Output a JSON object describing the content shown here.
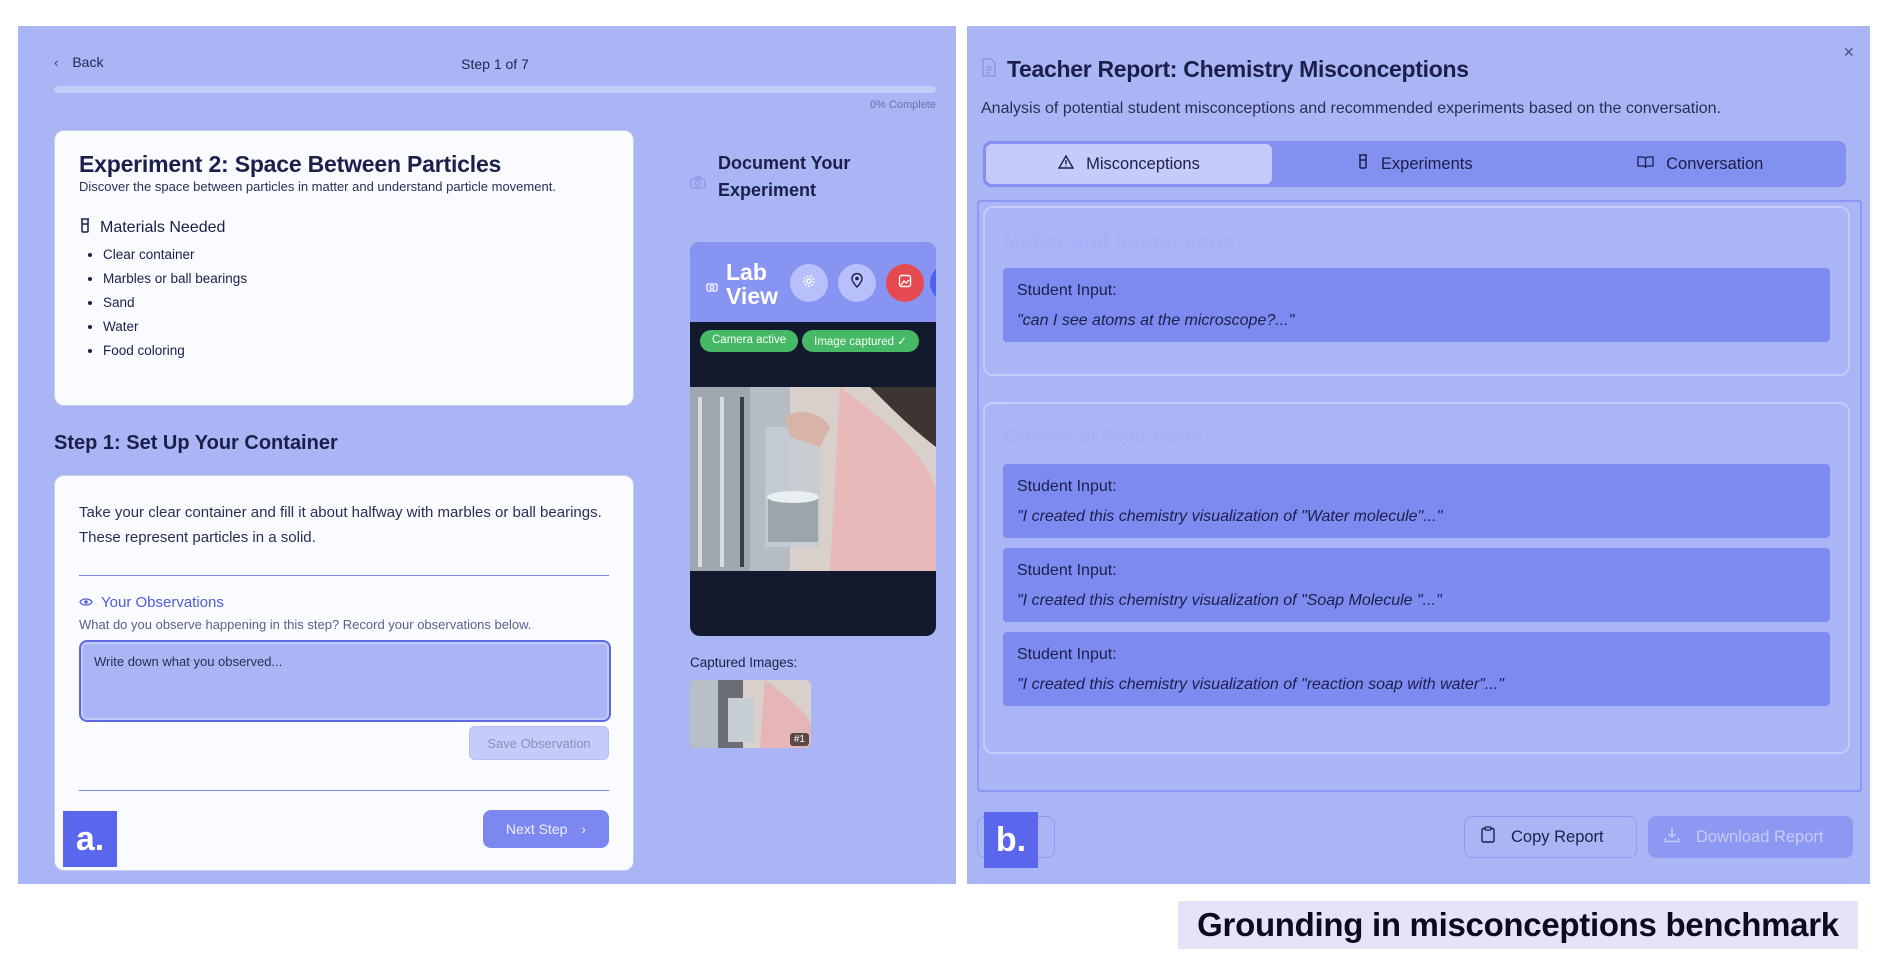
{
  "panel_a": {
    "badge": "a.",
    "back_label": "Back",
    "step_indicator": "Step 1 of 7",
    "progress_label": "0% Complete",
    "progress_fraction": 0.0,
    "experiment": {
      "title": "Experiment 2: Space Between Particles",
      "subtitle": "Discover the space between particles in matter and understand particle movement.",
      "materials_heading": "Materials Needed",
      "materials": [
        "Clear container",
        "Marbles or ball bearings",
        "Sand",
        "Water",
        "Food coloring"
      ]
    },
    "step": {
      "title": "Step 1: Set Up Your Container",
      "instruction": "Take your clear container and fill it about halfway with marbles or ball bearings. These represent particles in a solid.",
      "observations_heading": "Your Observations",
      "observations_hint": "What do you observe happening in this step? Record your observations below.",
      "observation_placeholder": "Write down what you observed...",
      "save_label": "Save Observation",
      "next_label": "Next Step"
    },
    "camera": {
      "heading": "Document Your Experiment",
      "lab_title_line1": "Lab",
      "lab_title_line2": "View",
      "status_camera": "Camera active",
      "status_capture": "Image captured ✓",
      "captured_label": "Captured Images:",
      "thumb_tag": "#1"
    }
  },
  "panel_b": {
    "badge": "b.",
    "title": "Teacher Report: Chemistry Misconceptions",
    "subtitle": "Analysis of potential student misconceptions and recommended experiments based on the conversation.",
    "tabs": [
      {
        "label": "Misconceptions",
        "icon": "warning-triangle-icon"
      },
      {
        "label": "Experiments",
        "icon": "beaker-icon"
      },
      {
        "label": "Conversation",
        "icon": "book-icon"
      }
    ],
    "groups": [
      {
        "title": "Matter and Interactions",
        "inputs": [
          {
            "label": "Student Input:",
            "quote": "\"can I see atoms at the microscope?...\""
          }
        ]
      },
      {
        "title": "Chemical Reactions",
        "inputs": [
          {
            "label": "Student Input:",
            "quote": "\"I created this chemistry visualization of \"Water molecule\"...\""
          },
          {
            "label": "Student Input:",
            "quote": "\"I created this chemistry visualization of \"Soap Molecule \"...\""
          },
          {
            "label": "Student Input:",
            "quote": "\"I created this chemistry visualization of \"reaction soap with water\"...\""
          }
        ]
      }
    ],
    "partial_button": "e",
    "copy_label": "Copy Report",
    "download_label": "Download Report"
  },
  "caption": "Grounding in misconceptions benchmark"
}
